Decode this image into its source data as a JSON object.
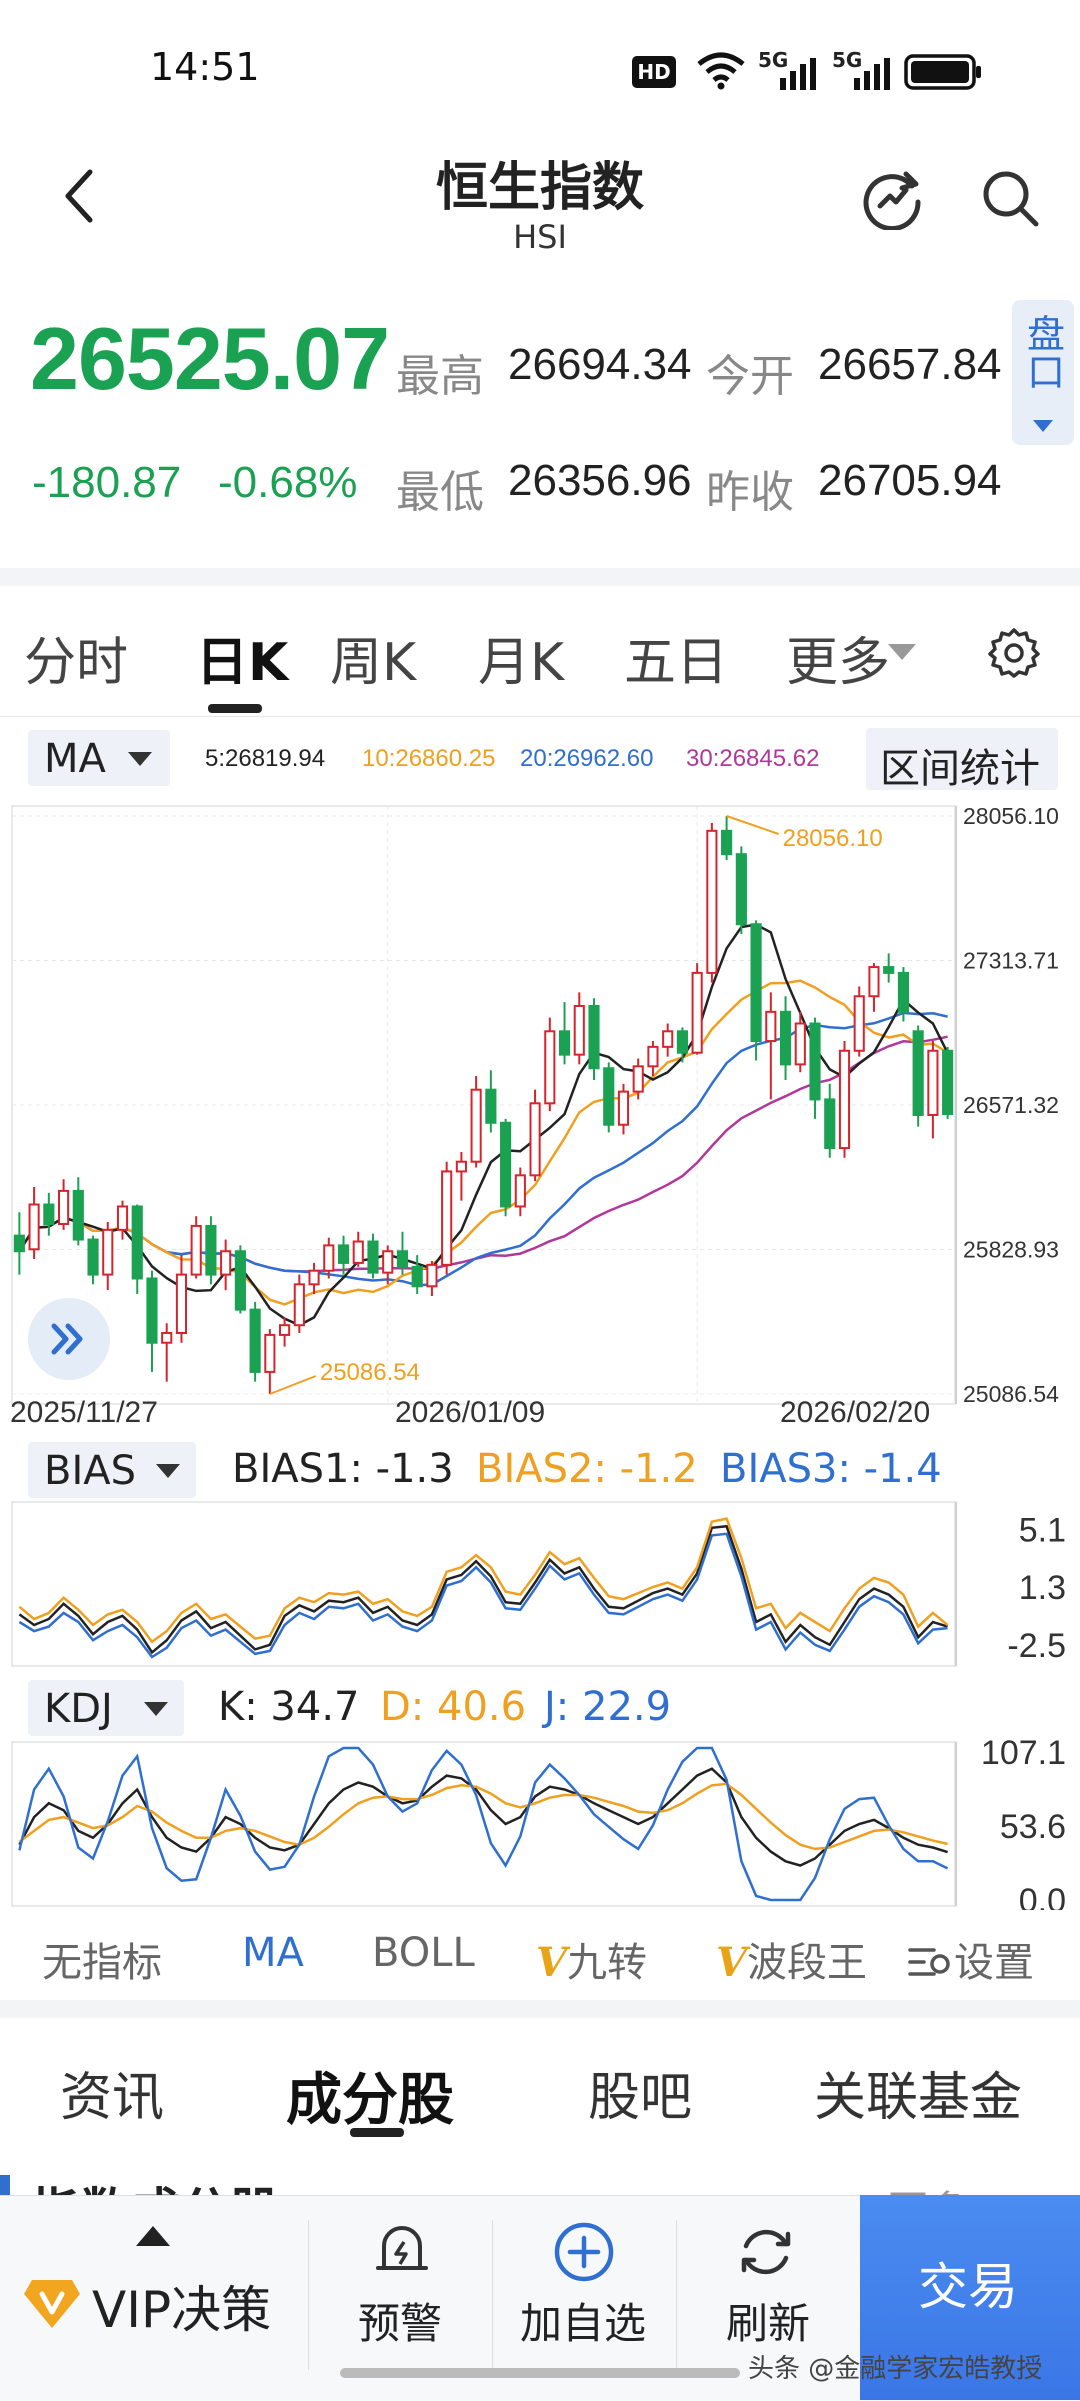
{
  "status": {
    "time": "14:51",
    "hd": "HD",
    "signal1": "5G",
    "signal2": "5G"
  },
  "header": {
    "title": "恒生指数",
    "subtitle": "HSI"
  },
  "quote": {
    "price": "26525.07",
    "change": "-180.87",
    "change_pct": "-0.68%",
    "high_label": "最高",
    "high": "26694.34",
    "open_label": "今开",
    "open": "26657.84",
    "low_label": "最低",
    "low": "26356.96",
    "prev_label": "昨收",
    "prev": "26705.94",
    "pankou": "盘口"
  },
  "tabs": [
    "分时",
    "日K",
    "周K",
    "月K",
    "五日",
    "更多"
  ],
  "ma_bar": {
    "selector": "MA",
    "ma5": "5:26819.94",
    "ma10": "10:26860.25",
    "ma20": "20:26962.60",
    "ma30": "30:26845.62",
    "range_stats": "区间统计"
  },
  "chart_data": [
    {
      "type": "candlestick",
      "y_ticks": [
        "28056.10",
        "27313.71",
        "26571.32",
        "25828.93",
        "25086.54"
      ],
      "ylim": [
        25086.54,
        28056.1
      ],
      "x_labels": [
        "2025/11/27",
        "2026/01/09",
        "2026/02/20"
      ],
      "annotations": {
        "max": "28056.10",
        "min": "25086.54"
      },
      "candles": [
        [
          25900,
          26020,
          25700,
          25820
        ],
        [
          25830,
          26150,
          25780,
          26060
        ],
        [
          26060,
          26120,
          25900,
          25960
        ],
        [
          25960,
          26190,
          25930,
          26130
        ],
        [
          26130,
          26200,
          25850,
          25880
        ],
        [
          25880,
          25900,
          25650,
          25700
        ],
        [
          25700,
          25970,
          25620,
          25930
        ],
        [
          25930,
          26080,
          25880,
          26050
        ],
        [
          26050,
          26060,
          25600,
          25680
        ],
        [
          25680,
          25720,
          25200,
          25350
        ],
        [
          25350,
          25450,
          25150,
          25400
        ],
        [
          25400,
          25800,
          25350,
          25700
        ],
        [
          25700,
          26000,
          25680,
          25950
        ],
        [
          25950,
          26000,
          25650,
          25700
        ],
        [
          25700,
          25880,
          25620,
          25820
        ],
        [
          25820,
          25850,
          25500,
          25520
        ],
        [
          25520,
          25560,
          25150,
          25200
        ],
        [
          25200,
          25420,
          25086.54,
          25390
        ],
        [
          25390,
          25480,
          25330,
          25440
        ],
        [
          25440,
          25700,
          25400,
          25650
        ],
        [
          25650,
          25760,
          25600,
          25720
        ],
        [
          25720,
          25890,
          25680,
          25850
        ],
        [
          25850,
          25900,
          25700,
          25760
        ],
        [
          25760,
          25920,
          25740,
          25870
        ],
        [
          25870,
          25910,
          25680,
          25710
        ],
        [
          25710,
          25850,
          25650,
          25820
        ],
        [
          25820,
          25920,
          25700,
          25740
        ],
        [
          25740,
          25800,
          25600,
          25640
        ],
        [
          25640,
          25770,
          25590,
          25750
        ],
        [
          25750,
          26280,
          25700,
          26230
        ],
        [
          26230,
          26330,
          26080,
          26280
        ],
        [
          26280,
          26720,
          26250,
          26650
        ],
        [
          26650,
          26750,
          26430,
          26480
        ],
        [
          26480,
          26500,
          26000,
          26050
        ],
        [
          26050,
          26250,
          26000,
          26210
        ],
        [
          26210,
          26650,
          26180,
          26580
        ],
        [
          26580,
          27020,
          26540,
          26950
        ],
        [
          26950,
          27100,
          26780,
          26830
        ],
        [
          26830,
          27150,
          26780,
          27080
        ],
        [
          27080,
          27120,
          26700,
          26760
        ],
        [
          26760,
          26790,
          26430,
          26470
        ],
        [
          26470,
          26680,
          26420,
          26640
        ],
        [
          26640,
          26810,
          26600,
          26770
        ],
        [
          26770,
          26900,
          26720,
          26870
        ],
        [
          26870,
          26990,
          26820,
          26950
        ],
        [
          26950,
          26970,
          26790,
          26840
        ],
        [
          26840,
          27300,
          26830,
          27250
        ],
        [
          27250,
          28020,
          27200,
          27980
        ],
        [
          27980,
          28056.1,
          27830,
          27860
        ],
        [
          27860,
          27900,
          27450,
          27500
        ],
        [
          27500,
          27520,
          26800,
          26900
        ],
        [
          26900,
          27150,
          26600,
          27050
        ],
        [
          27050,
          27130,
          26700,
          26780
        ],
        [
          26780,
          27050,
          26740,
          26990
        ],
        [
          26990,
          27020,
          26500,
          26600
        ],
        [
          26600,
          26680,
          26300,
          26350
        ],
        [
          26350,
          26900,
          26300,
          26850
        ],
        [
          26850,
          27180,
          26820,
          27130
        ],
        [
          27130,
          27300,
          27050,
          27280
        ],
        [
          27280,
          27350,
          27200,
          27250
        ],
        [
          27250,
          27280,
          27000,
          27050
        ],
        [
          26950,
          26980,
          26460,
          26520
        ],
        [
          26520,
          26900,
          26400,
          26850
        ],
        [
          26850,
          26870,
          26500,
          26525.07
        ]
      ]
    },
    {
      "type": "line",
      "name": "BIAS",
      "y_ticks": [
        "5.1",
        "1.3",
        "-2.5"
      ],
      "ylim": [
        -3.5,
        6.5
      ],
      "series": [
        {
          "name": "BIAS1: -1.3",
          "color": "#222222",
          "values": [
            -0.5,
            -1.2,
            -0.8,
            0.2,
            -0.6,
            -1.8,
            -1.0,
            -0.6,
            -1.5,
            -3.0,
            -2.2,
            -0.9,
            -0.3,
            -1.4,
            -1.0,
            -1.9,
            -2.8,
            -2.5,
            -0.6,
            0.1,
            -0.3,
            0.4,
            0.3,
            0.6,
            -0.4,
            0.0,
            -0.9,
            -1.2,
            -0.5,
            1.8,
            2.1,
            3.0,
            2.0,
            0.3,
            0.2,
            1.6,
            3.1,
            2.2,
            2.6,
            1.2,
            0.0,
            -0.1,
            0.4,
            0.9,
            1.2,
            0.8,
            2.2,
            5.2,
            5.3,
            2.5,
            -1.0,
            -0.5,
            -2.3,
            -1.2,
            -2.0,
            -2.5,
            -1.0,
            0.5,
            1.2,
            0.8,
            0.0,
            -2.0,
            -1.0,
            -1.3
          ]
        },
        {
          "name": "BIAS2: -1.2",
          "color": "#f0a020",
          "values": [
            0.0,
            -0.8,
            -0.4,
            0.6,
            -0.2,
            -1.2,
            -0.5,
            -0.2,
            -1.0,
            -2.3,
            -1.6,
            -0.4,
            0.2,
            -0.8,
            -0.5,
            -1.3,
            -2.1,
            -1.9,
            -0.1,
            0.6,
            0.3,
            0.9,
            0.8,
            1.0,
            0.2,
            0.5,
            -0.3,
            -0.6,
            0.0,
            2.3,
            2.6,
            3.4,
            2.6,
            1.0,
            0.8,
            2.1,
            3.6,
            2.8,
            3.2,
            1.9,
            0.7,
            0.5,
            0.9,
            1.3,
            1.6,
            1.2,
            2.6,
            5.6,
            5.8,
            3.2,
            -0.1,
            0.2,
            -1.4,
            -0.4,
            -1.0,
            -1.6,
            -0.1,
            1.2,
            1.9,
            1.6,
            0.8,
            -1.3,
            -0.4,
            -1.2
          ]
        },
        {
          "name": "BIAS3: -1.4",
          "color": "#2f6fd0",
          "values": [
            -1.0,
            -1.6,
            -1.3,
            -0.4,
            -1.0,
            -2.2,
            -1.6,
            -1.2,
            -2.0,
            -3.3,
            -2.7,
            -1.4,
            -0.9,
            -1.9,
            -1.5,
            -2.3,
            -3.1,
            -2.9,
            -1.2,
            -0.4,
            -0.8,
            0.0,
            -0.1,
            0.2,
            -0.9,
            -0.5,
            -1.3,
            -1.6,
            -0.9,
            1.4,
            1.7,
            2.6,
            1.6,
            -0.1,
            -0.2,
            1.2,
            2.7,
            1.8,
            2.2,
            0.8,
            -0.4,
            -0.5,
            0.0,
            0.5,
            0.8,
            0.4,
            1.8,
            4.7,
            4.8,
            2.0,
            -1.5,
            -1.0,
            -2.8,
            -1.7,
            -2.5,
            -2.9,
            -1.5,
            0.0,
            0.7,
            0.3,
            -0.5,
            -2.4,
            -1.5,
            -1.4
          ]
        }
      ]
    },
    {
      "type": "line",
      "name": "KDJ",
      "y_ticks": [
        "107.1",
        "53.6",
        "0.0"
      ],
      "ylim": [
        0,
        110
      ],
      "series": [
        {
          "name": "K: 34.7",
          "color": "#222222",
          "values": [
            40,
            60,
            70,
            65,
            50,
            45,
            55,
            70,
            80,
            60,
            45,
            38,
            35,
            45,
            60,
            55,
            45,
            38,
            36,
            40,
            55,
            70,
            80,
            85,
            82,
            75,
            70,
            72,
            82,
            90,
            88,
            80,
            65,
            55,
            60,
            75,
            82,
            80,
            76,
            70,
            65,
            60,
            55,
            60,
            70,
            80,
            90,
            95,
            85,
            60,
            45,
            35,
            28,
            25,
            30,
            40,
            50,
            55,
            58,
            52,
            45,
            40,
            38,
            34.7
          ]
        },
        {
          "name": "D: 40.6",
          "color": "#f0a020",
          "values": [
            42,
            50,
            58,
            60,
            56,
            52,
            54,
            60,
            68,
            64,
            56,
            50,
            45,
            45,
            50,
            52,
            50,
            46,
            42,
            40,
            45,
            53,
            62,
            70,
            74,
            75,
            73,
            73,
            76,
            81,
            83,
            82,
            77,
            70,
            67,
            70,
            74,
            76,
            76,
            74,
            71,
            68,
            64,
            63,
            65,
            70,
            77,
            83,
            84,
            76,
            66,
            56,
            47,
            40,
            37,
            38,
            42,
            46,
            50,
            51,
            49,
            46,
            43,
            40.6
          ]
        },
        {
          "name": "J: 22.9",
          "color": "#2f6fd0",
          "values": [
            36,
            80,
            95,
            75,
            38,
            30,
            57,
            90,
            104,
            52,
            23,
            14,
            15,
            45,
            80,
            61,
            35,
            22,
            24,
            40,
            75,
            104,
            116,
            115,
            98,
            75,
            64,
            70,
            94,
            108,
            98,
            76,
            41,
            25,
            46,
            85,
            98,
            88,
            76,
            62,
            53,
            44,
            37,
            54,
            80,
            100,
            116,
            119,
            87,
            28,
            3,
            -7,
            -10,
            -5,
            16,
            44,
            66,
            73,
            74,
            54,
            37,
            28,
            28,
            22.9
          ]
        }
      ]
    }
  ],
  "bias_bar": {
    "selector": "BIAS",
    "b1": "BIAS1: -1.3",
    "b2": "BIAS2: -1.2",
    "b3": "BIAS3: -1.4"
  },
  "kdj_bar": {
    "selector": "KDJ",
    "k": "K: 34.7",
    "d": "D: 40.6",
    "j": "J: 22.9"
  },
  "indicator_tabs": {
    "none": "无指标",
    "ma": "MA",
    "boll": "BOLL",
    "v1": "V",
    "jiuzhuan": "九转",
    "v2": "V",
    "boduan": "波段王",
    "settings": "设置"
  },
  "bottom_tabs": [
    "资讯",
    "成分股",
    "股吧",
    "关联基金"
  ],
  "section_peek": {
    "title": "指数成分股",
    "more": "更多"
  },
  "bottom_nav": {
    "vip": "VIP决策",
    "alert": "预警",
    "add": "加自选",
    "refresh": "刷新",
    "trade": "交易"
  },
  "watermark": "头条 @金融学家宏皓教授",
  "colors": {
    "up": "#d6242c",
    "down": "#1aa152",
    "ma5": "#222222",
    "ma10": "#f0a020",
    "ma20": "#2f6fd0",
    "ma30": "#b0389a",
    "accent": "#3b76e6"
  }
}
